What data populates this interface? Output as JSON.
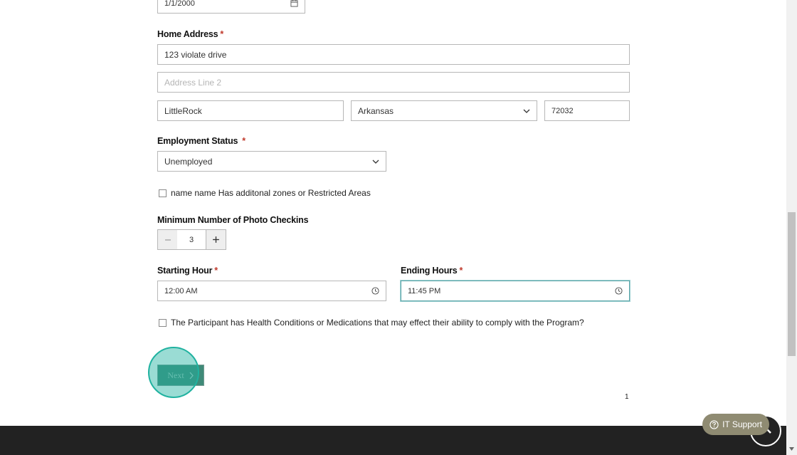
{
  "dob": {
    "value": "1/1/2000"
  },
  "home_address": {
    "label": "Home Address",
    "required_mark": "*",
    "line1_value": "123 violate drive",
    "line2_placeholder": "Address Line 2",
    "city_value": "LittleRock",
    "state_selected": "Arkansas",
    "zip_value": "72032"
  },
  "employment": {
    "label": "Employment Status",
    "required_mark": "*",
    "selected": "Unemployed"
  },
  "zones_checkbox": {
    "label": "name name Has additonal zones or Restricted Areas"
  },
  "photo_checkins": {
    "label": "Minimum Number of Photo Checkins",
    "value": "3",
    "minus": "−",
    "plus": "+"
  },
  "starting_hour": {
    "label": "Starting Hour",
    "required_mark": "*",
    "value": "12:00 AM"
  },
  "ending_hours": {
    "label": "Ending Hours",
    "required_mark": "*",
    "value": "11:45 PM"
  },
  "health_checkbox": {
    "label": "The Participant has Health Conditions or Medications that may effect their ability to comply with the Program?"
  },
  "next_button": {
    "label": "Next"
  },
  "page_number": "1",
  "support_button": {
    "label": "IT Support"
  },
  "colors": {
    "accent_focus": "#5aa5a8",
    "next_button_bg": "#3f8a78",
    "click_indicator": "#20b2a0",
    "support_bg": "#8f8b72",
    "footer_bg": "#222222"
  }
}
